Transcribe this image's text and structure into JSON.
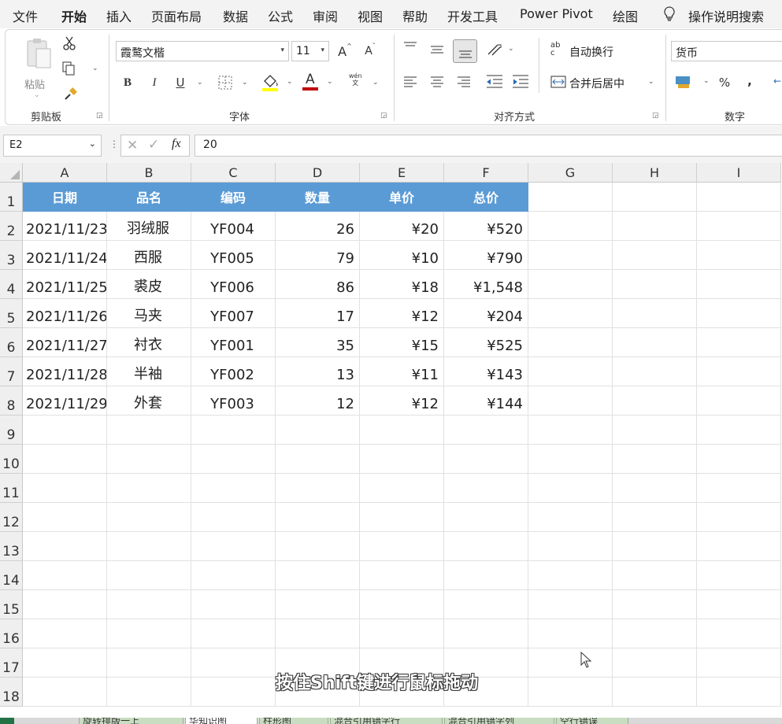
{
  "menu": [
    "文件",
    "开始",
    "插入",
    "页面布局",
    "数据",
    "公式",
    "审阅",
    "视图",
    "帮助",
    "开发工具",
    "Power Pivot",
    "绘图"
  ],
  "active_menu": "开始",
  "tell_me": "操作说明搜索",
  "ribbon": {
    "clipboard": {
      "paste_label": "粘贴",
      "group_label": "剪贴板"
    },
    "font": {
      "font_name": "霞鹜文楷",
      "font_size": "11",
      "group_label": "字体",
      "bold": "B",
      "italic": "I",
      "underline": "U",
      "font_color_letter": "A",
      "phonetic": "wén\n文",
      "increase": "A",
      "decrease": "A"
    },
    "alignment": {
      "wrap_text": "自动换行",
      "merge_center": "合并后居中",
      "group_label": "对齐方式",
      "wrap_icon_text": "ab\nc"
    },
    "number": {
      "format": "货币",
      "group_label": "数字",
      "percent": "%",
      "comma": ","
    }
  },
  "formula_bar": {
    "name_box": "E2",
    "fx": "fx",
    "value": "20"
  },
  "columns": [
    "A",
    "B",
    "C",
    "D",
    "E",
    "F",
    "G",
    "H",
    "I"
  ],
  "rows": [
    "1",
    "2",
    "3",
    "4",
    "5",
    "6",
    "7",
    "8",
    "9",
    "10",
    "11",
    "12",
    "13",
    "14",
    "15",
    "16",
    "17",
    "18"
  ],
  "table": {
    "headers": [
      "日期",
      "品名",
      "编码",
      "数量",
      "单价",
      "总价"
    ],
    "rows": [
      [
        "2021/11/23",
        "羽绒服",
        "YF004",
        "26",
        "¥20",
        "¥520"
      ],
      [
        "2021/11/24",
        "西服",
        "YF005",
        "79",
        "¥10",
        "¥790"
      ],
      [
        "2021/11/25",
        "裘皮",
        "YF006",
        "86",
        "¥18",
        "¥1,548"
      ],
      [
        "2021/11/26",
        "马夹",
        "YF007",
        "17",
        "¥12",
        "¥204"
      ],
      [
        "2021/11/27",
        "衬衣",
        "YF001",
        "35",
        "¥15",
        "¥525"
      ],
      [
        "2021/11/28",
        "半袖",
        "YF002",
        "13",
        "¥11",
        "¥143"
      ],
      [
        "2021/11/29",
        "外套",
        "YF003",
        "12",
        "¥12",
        "¥144"
      ]
    ]
  },
  "subtitle": "按住Shift键进行鼠标拖动",
  "sheet_tabs": [
    "旋转排版一上",
    "华知识图",
    "柱形图",
    "混合引用错字行",
    "混合引用错字列",
    "空行错误"
  ],
  "colors": {
    "header_fill": "#5b9bd5",
    "header_text": "#ffffff",
    "font_color_bar": "#c00000",
    "fill_color_bar": "#ffff00"
  }
}
